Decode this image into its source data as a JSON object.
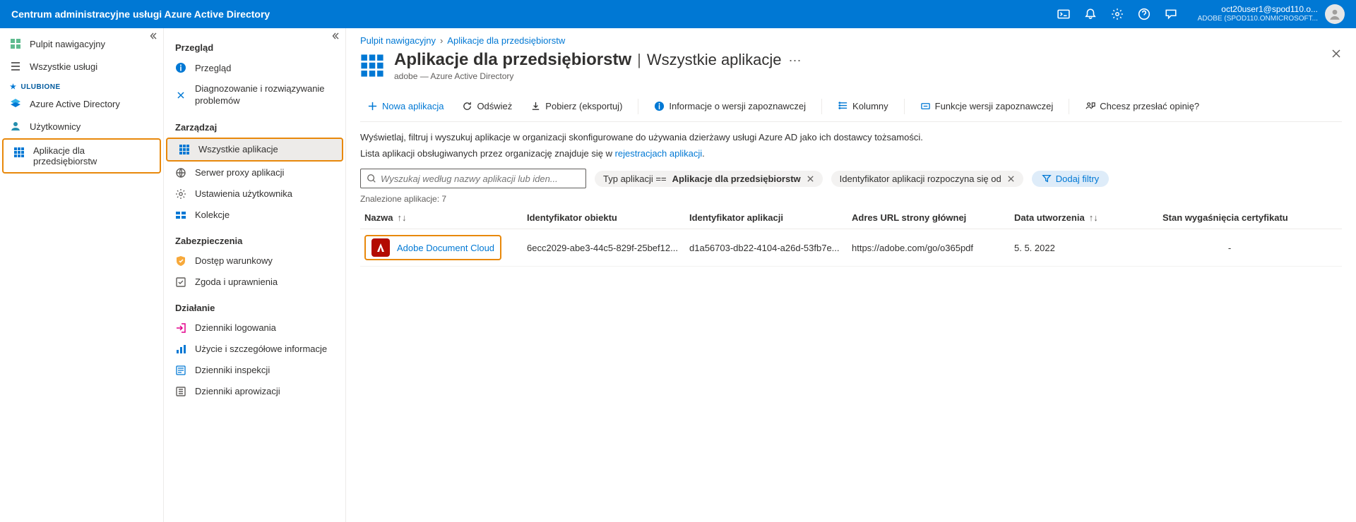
{
  "topbar": {
    "title": "Centrum administracyjne usługi Azure Active Directory",
    "user_email": "oct20user1@spod110.o...",
    "user_org": "ADOBE (SPOD110.ONMICROSOFT..."
  },
  "nav": {
    "dashboard": "Pulpit nawigacyjny",
    "all_services": "Wszystkie usługi",
    "fav_header": "ULUBIONE",
    "aad": "Azure Active Directory",
    "users": "Użytkownicy",
    "ent_apps": "Aplikacje dla przedsiębiorstw"
  },
  "sub": {
    "overview_h": "Przegląd",
    "overview": "Przegląd",
    "diag": "Diagnozowanie i rozwiązywanie problemów",
    "manage_h": "Zarządzaj",
    "all_apps": "Wszystkie aplikacje",
    "proxy": "Serwer proxy aplikacji",
    "user_settings": "Ustawienia użytkownika",
    "collections": "Kolekcje",
    "sec_h": "Zabezpieczenia",
    "cond_access": "Dostęp warunkowy",
    "consent": "Zgoda i uprawnienia",
    "activity_h": "Działanie",
    "signins": "Dzienniki logowania",
    "usage": "Użycie i szczegółowe informacje",
    "audit": "Dzienniki inspekcji",
    "prov": "Dzienniki aprowizacji"
  },
  "breadcrumb": {
    "dashboard": "Pulpit nawigacyjny",
    "ent_apps": "Aplikacje dla przedsiębiorstw"
  },
  "page": {
    "title_bold": "Aplikacje dla przedsiębiorstw",
    "title_sub": "Wszystkie aplikacje",
    "subtitle": "adobe — Azure Active Directory"
  },
  "toolbar": {
    "new": "Nowa aplikacja",
    "refresh": "Odśwież",
    "download": "Pobierz (eksportuj)",
    "preview_info": "Informacje o wersji zapoznawczej",
    "columns": "Kolumny",
    "preview_features": "Funkcje wersji zapoznawczej",
    "feedback": "Chcesz przesłać opinię?"
  },
  "desc": {
    "line1": "Wyświetlaj, filtruj i wyszukuj aplikacje w organizacji skonfigurowane do używania dzierżawy usługi Azure AD jako ich dostawcy tożsamości.",
    "line2_pre": "Lista aplikacji obsługiwanych przez organizację znajduje się w ",
    "line2_link": "rejestracjach aplikacji"
  },
  "filters": {
    "search_placeholder": "Wyszukaj według nazwy aplikacji lub iden...",
    "pill1_pre": "Typ aplikacji == ",
    "pill1_strong": "Aplikacje dla przedsiębiorstw",
    "pill2": "Identyfikator aplikacji rozpoczyna się od",
    "add": "Dodaj filtry"
  },
  "results": {
    "count_label": "Znalezione aplikacje: 7"
  },
  "columns": {
    "name": "Nazwa",
    "object_id": "Identyfikator obiektu",
    "app_id": "Identyfikator aplikacji",
    "url": "Adres URL strony głównej",
    "created": "Data utworzenia",
    "cert": "Stan wygaśnięcia certyfikatu"
  },
  "rows": [
    {
      "name": "Adobe Document Cloud",
      "object_id": "6ecc2029-abe3-44c5-829f-25bef12...",
      "app_id": "d1a56703-db22-4104-a26d-53fb7e...",
      "url": "https://adobe.com/go/o365pdf",
      "created": "5. 5. 2022",
      "cert": "-"
    }
  ]
}
